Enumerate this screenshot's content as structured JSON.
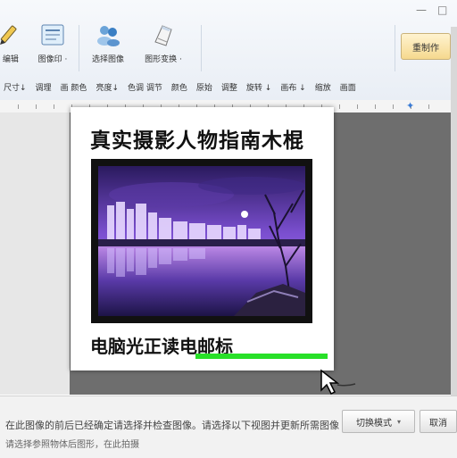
{
  "app": {
    "window_title": "",
    "win_buttons": [
      "—",
      "□"
    ]
  },
  "toolbar": {
    "tools": [
      {
        "icon": "pencil-icon",
        "label": "· 编辑"
      },
      {
        "icon": "clipboard-icon",
        "label": "图像印 ·"
      },
      {
        "icon": "people-icon",
        "label": "选择图像"
      },
      {
        "icon": "document-icon",
        "label": "图形变换 ·"
      }
    ],
    "right_button": "重制作"
  },
  "format_row": [
    "尺寸↓ ",
    "调理",
    "画 颜色",
    "亮度↓",
    "色调 调节",
    "颜色",
    "原始",
    "调整",
    "旋转 ↓",
    "画布 ↓",
    "缩放 ",
    "画面"
  ],
  "card": {
    "title": "真实摄影人物指南木棍",
    "caption": "电脑光正读电邮标"
  },
  "status": {
    "text1": "在此图像的前后已经确定请选择并检查图像。请选择以下视图并更新所需图像",
    "text2": "请选择参照物体后图形，在此拍摄",
    "button1": "切换模式",
    "button2": "取消"
  },
  "colors": {
    "underline": "#28e028",
    "canvas": "#6e6e6e",
    "accent_button": "#f6d98e"
  }
}
